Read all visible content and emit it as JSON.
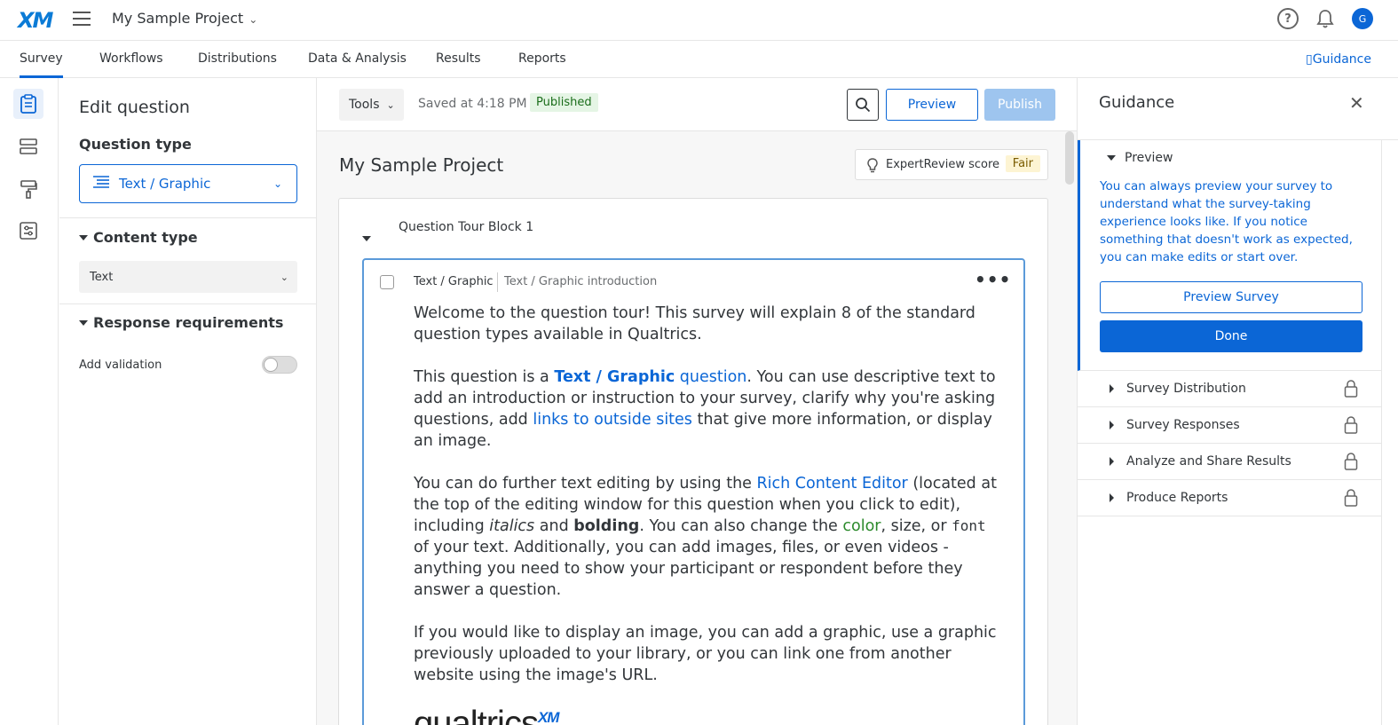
{
  "app": {
    "logo": "XM",
    "project_title": "My Sample Project",
    "avatar_initial": "G",
    "help_glyph": "?"
  },
  "nav": {
    "tabs": [
      "Survey",
      "Workflows",
      "Distributions",
      "Data & Analysis",
      "Results",
      "Reports"
    ],
    "active_tab": "Survey",
    "guidance_link": "Guidance"
  },
  "edit_panel": {
    "title": "Edit question",
    "question_type_label": "Question type",
    "question_type_value": "Text / Graphic",
    "content_type_label": "Content type",
    "content_type_value": "Text",
    "response_requirements_label": "Response requirements",
    "add_validation_label": "Add validation",
    "add_validation_on": false
  },
  "toolbar": {
    "tools_label": "Tools",
    "saved_text": "Saved at 4:18 PM",
    "status_badge": "Published",
    "preview_label": "Preview",
    "publish_label": "Publish"
  },
  "survey": {
    "title": "My Sample Project",
    "expert_review_label": "ExpertReview score",
    "expert_review_value": "Fair",
    "block_title": "Question Tour Block 1",
    "question": {
      "type": "Text / Graphic",
      "name": "Text / Graphic introduction",
      "more_glyph": "•••",
      "p1": "Welcome to the question tour! This survey will explain 8 of the standard question types available in Qualtrics.",
      "p2_a": "This question is a ",
      "p2_link1_bold": "Text / Graphic",
      "p2_link1_rest": " question",
      "p2_b": ". You can use descriptive text to add an introduction or instruction to your survey, clarify why you're asking questions, add ",
      "p2_link2": "links to outside sites",
      "p2_c": " that give more information, or display an image.",
      "p3_a": "You can do further text editing by using the ",
      "p3_link": "Rich Content Editor",
      "p3_b": " (located at the top of the editing window for this question when you click to edit), including ",
      "p3_italic": "italics",
      "p3_c": " and ",
      "p3_bold": "bolding",
      "p3_d": ". You can also change the ",
      "p3_color": "color",
      "p3_e": ", size, or ",
      "p3_font": "font",
      "p3_f": " of your text. Additionally, you can add images, files, or even videos - anything you need to show your participant or respondent before they answer a question.",
      "p4": "If you would like to display an image, you can add a graphic, use a graphic previously uploaded to your library, or you can link one from another website using the image's URL.",
      "logo_text": "qualtrics",
      "logo_sup": "XM"
    }
  },
  "guidance": {
    "title": "Guidance",
    "active_section": {
      "title": "Preview",
      "description": "You can always preview your survey to understand what the survey-taking experience looks like. If you notice something that doesn't work as expected, you can make edits or start over.",
      "preview_button": "Preview Survey",
      "done_button": "Done"
    },
    "sections": [
      "Survey Distribution",
      "Survey Responses",
      "Analyze and Share Results",
      "Produce Reports"
    ]
  },
  "colors": {
    "accent": "#0b66d6",
    "published_bg": "#e5f5e5",
    "fair_bg": "#fdf4d3"
  }
}
